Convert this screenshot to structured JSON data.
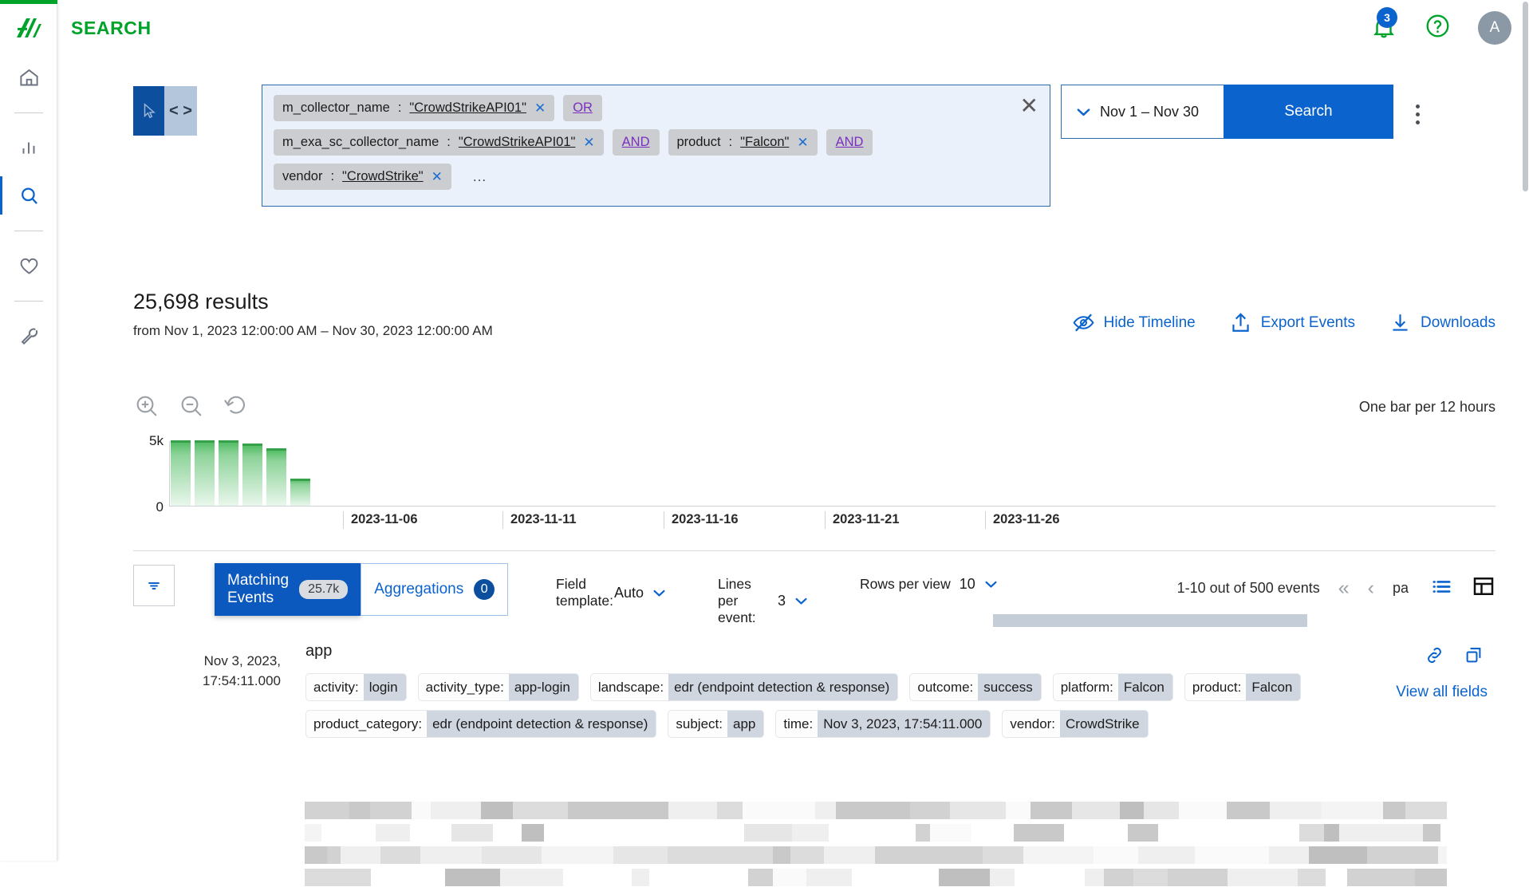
{
  "app": {
    "title": "SEARCH",
    "logo": "exabeam-logo"
  },
  "header": {
    "notifications_count": "3",
    "avatar_initial": "A",
    "bell_icon": "bell-icon",
    "help_icon": "help-circle-icon"
  },
  "sidebar": {
    "items": [
      {
        "name": "home",
        "icon": "home-icon",
        "active": false
      },
      {
        "name": "analytics",
        "icon": "bar-chart-icon",
        "active": false
      },
      {
        "name": "search",
        "icon": "search-icon",
        "active": true
      },
      {
        "name": "favorites",
        "icon": "heart-icon",
        "active": false
      },
      {
        "name": "settings",
        "icon": "wrench-icon",
        "active": false
      }
    ]
  },
  "query": {
    "mode_pointer_icon": "cursor-arrow-icon",
    "mode_code_label": "< >",
    "clear_label": "✕",
    "ellipsis": "...",
    "rows": [
      {
        "chips": [
          {
            "field": "m_collector_name",
            "sep": ":",
            "value": "\"CrowdStrikeAPI01\"",
            "remove": "✕"
          }
        ],
        "operator": "OR"
      },
      {
        "chips": [
          {
            "field": "m_exa_sc_collector_name",
            "sep": ":",
            "value": "\"CrowdStrikeAPI01\"",
            "remove": "✕"
          }
        ],
        "operator": "AND",
        "chips2": [
          {
            "field": "product",
            "sep": ":",
            "value": "\"Falcon\"",
            "remove": "✕"
          }
        ],
        "operator2": "AND"
      },
      {
        "chips": [
          {
            "field": "vendor",
            "sep": ":",
            "value": "\"CrowdStrike\"",
            "remove": "✕"
          }
        ]
      }
    ],
    "date_range": "Nov 1 – Nov 30",
    "search_button": "Search",
    "more_menu": "kebab-menu"
  },
  "results": {
    "count_text": "25,698 results",
    "range_text": "from Nov 1, 2023 12:00:00 AM – Nov 30, 2023 12:00:00 AM",
    "actions": [
      {
        "label": "Hide Timeline",
        "icon": "eye-off-icon"
      },
      {
        "label": "Export Events",
        "icon": "upload-icon"
      },
      {
        "label": "Downloads",
        "icon": "download-icon"
      }
    ]
  },
  "timeline": {
    "zoom_in_icon": "zoom-in-icon",
    "zoom_out_icon": "zoom-out-icon",
    "reset_icon": "reset-icon",
    "bar_interval": "One bar per 12 hours"
  },
  "chart_data": {
    "type": "bar",
    "title": "",
    "xlabel": "",
    "ylabel": "",
    "ylim": [
      0,
      5000
    ],
    "ytick_labels": [
      "5k",
      "0"
    ],
    "grid": false,
    "legend": false,
    "bar_interval": "One bar per 12 hours",
    "categories": [
      "2023-11-01 00:00",
      "2023-11-01 12:00",
      "2023-11-02 00:00",
      "2023-11-02 12:00",
      "2023-11-03 00:00",
      "2023-11-03 12:00"
    ],
    "values": [
      5000,
      5000,
      5000,
      4750,
      4400,
      2050
    ],
    "xtick_labels": [
      "2023-11-06",
      "2023-11-11",
      "2023-11-16",
      "2023-11-21",
      "2023-11-26"
    ],
    "bar_color": "#49b95c"
  },
  "toolbar": {
    "filter_icon": "filter-icon",
    "tabs": [
      {
        "label_line1": "Matching",
        "label_line2": "Events",
        "badge": "25.7k",
        "active": true
      },
      {
        "label_line1": "Aggregations",
        "label_line2": "",
        "badge": "0",
        "active": false
      }
    ],
    "field_template_label": "Field template:",
    "field_template_value": "Auto",
    "lines_per_event_label_1": "Lines per",
    "lines_per_event_label_2": "event:",
    "lines_per_event_value": "3",
    "rows_per_view_label": "Rows per view",
    "rows_per_view_value": "10",
    "pagination_text": "1-10 out of 500 events",
    "first_page_icon": "«",
    "prev_page_icon": "‹",
    "page_label_truncated": "pa",
    "list_view_icon": "list-view-icon",
    "table_view_icon": "table-view-icon"
  },
  "event": {
    "timestamp_line1": "Nov 3, 2023,",
    "timestamp_line2": "17:54:11.000",
    "title": "app",
    "link_icon": "link-icon",
    "copy_icon": "copy-icon",
    "view_all_fields": "View all fields",
    "fields": [
      {
        "key": "activity:",
        "value": "login"
      },
      {
        "key": "activity_type:",
        "value": "app-login"
      },
      {
        "key": "landscape:",
        "value": "edr (endpoint detection & response)"
      },
      {
        "key": "outcome:",
        "value": "success"
      },
      {
        "key": "platform:",
        "value": "Falcon"
      },
      {
        "key": "product:",
        "value": "Falcon"
      },
      {
        "key": "product_category:",
        "value": "edr (endpoint detection & response)"
      },
      {
        "key": "subject:",
        "value": "app"
      },
      {
        "key": "time:",
        "value": "Nov 3, 2023, 17:54:11.000"
      },
      {
        "key": "vendor:",
        "value": "CrowdStrike"
      }
    ]
  },
  "colors": {
    "brand_green": "#00a32a",
    "accent_blue": "#0b63ce",
    "query_bg": "#eaf1fb",
    "chip_bg": "#cbcdd1",
    "operator_purple": "#7b2fbe"
  }
}
